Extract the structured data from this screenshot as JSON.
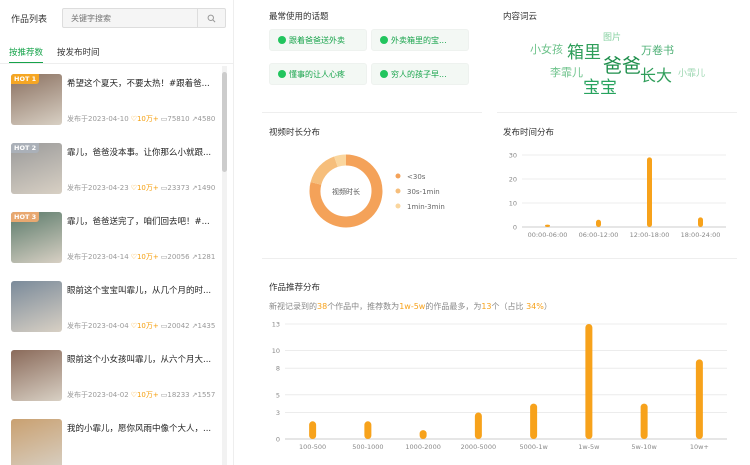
{
  "left": {
    "title": "作品列表",
    "search_placeholder": "关键字搜索",
    "tabs": [
      "按推荐数",
      "按发布时间"
    ],
    "items": [
      {
        "hot": "HOT 1",
        "title": "希望这个夏天，不要太热！#跟着爸...",
        "date": "发布于2023-04-10",
        "likes": "10万+",
        "comments": "75810",
        "shares": "4580",
        "thumb": "#8a7060"
      },
      {
        "hot": "HOT 2",
        "title": "霏儿，爸爸没本事。让你那么小就跟...",
        "date": "发布于2023-04-23",
        "likes": "10万+",
        "comments": "23373",
        "shares": "1490",
        "thumb": "#9a9a9a"
      },
      {
        "hot": "HOT 3",
        "title": "霏儿，爸爸送完了，咱们回去吧！#...",
        "date": "发布于2023-04-14",
        "likes": "10万+",
        "comments": "20056",
        "shares": "1281",
        "thumb": "#5a7a6a"
      },
      {
        "hot": "",
        "title": "眼前这个宝宝叫霏儿，从几个月的时...",
        "date": "发布于2023-04-04",
        "likes": "10万+",
        "comments": "20042",
        "shares": "1435",
        "thumb": "#7a8a9a"
      },
      {
        "hot": "",
        "title": "眼前这个小女孩叫霏儿，从六个月大...",
        "date": "发布于2023-04-02",
        "likes": "10万+",
        "comments": "18233",
        "shares": "1557",
        "thumb": "#8a6a5a"
      },
      {
        "hot": "",
        "title": "我的小霏儿，愿你风雨中像个大人，...",
        "date": "",
        "likes": "",
        "comments": "",
        "shares": "",
        "thumb": "#c9a070"
      }
    ]
  },
  "topics": {
    "title": "最常使用的话题",
    "items": [
      "跟着爸爸送外卖",
      "外卖箱里的宝...",
      "懂事的让人心疼",
      "穷人的孩子早..."
    ]
  },
  "wordcloud": {
    "title": "内容词云",
    "words": [
      {
        "text": "图片",
        "size": 9,
        "color": "#86d0a0"
      },
      {
        "text": "小女孩",
        "size": 11,
        "color": "#6cc28a"
      },
      {
        "text": "箱里",
        "size": 17,
        "color": "#2f9e5a"
      },
      {
        "text": "万卷书",
        "size": 11,
        "color": "#4caf74"
      },
      {
        "text": "爸爸",
        "size": 19,
        "color": "#1f8f4c"
      },
      {
        "text": "李霏儿",
        "size": 11,
        "color": "#6cc28a"
      },
      {
        "text": "长大",
        "size": 16,
        "color": "#2f9e5a"
      },
      {
        "text": "小霏儿",
        "size": 9,
        "color": "#9bd6b0"
      },
      {
        "text": "宝宝",
        "size": 17,
        "color": "#27a35e"
      }
    ]
  },
  "duration": {
    "title": "视频时长分布",
    "center_label": "视频时长",
    "colors": [
      "#f4a259",
      "#f6be7b",
      "#fad69e"
    ]
  },
  "publish": {
    "title": "发布时间分布"
  },
  "recommend": {
    "title": "作品推荐分布",
    "summary_parts": [
      "新视记录到的",
      "38",
      "个作品中，推荐数为",
      "1w-5w",
      "的作品最多，为",
      "13",
      "个（占比 ",
      "34%",
      "）"
    ]
  },
  "chart_data": [
    {
      "type": "pie",
      "categories": [
        "<30s",
        "30s-1min",
        "1min-3min"
      ],
      "values": [
        30,
        6,
        2
      ]
    },
    {
      "type": "bar",
      "categories": [
        "00:00-06:00",
        "06:00-12:00",
        "12:00-18:00",
        "18:00-24:00"
      ],
      "values": [
        1,
        3,
        29,
        4
      ],
      "ylim": [
        0,
        30
      ],
      "yticks": [
        0,
        10,
        20,
        30
      ]
    },
    {
      "type": "bar",
      "categories": [
        "100-500",
        "500-1000",
        "1000-2000",
        "2000-5000",
        "5000-1w",
        "1w-5w",
        "5w-10w",
        "10w+"
      ],
      "values": [
        2,
        2,
        1,
        3,
        4,
        13,
        4,
        9
      ],
      "ylim": [
        0,
        13
      ],
      "yticks": [
        0,
        3,
        5,
        8,
        10,
        13
      ]
    }
  ]
}
